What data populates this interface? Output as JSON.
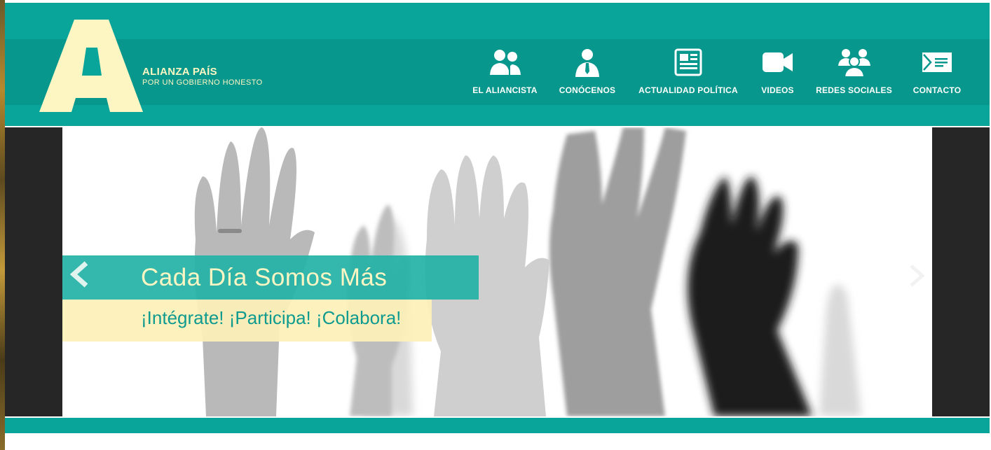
{
  "brand": {
    "title": "ALIANZA PAÍS",
    "subtitle": "POR UN GOBIERNO HONESTO",
    "logo_letter": "A",
    "logo_color": "#fdf6c3"
  },
  "colors": {
    "header_teal": "#0aa59a",
    "header_band": "#07978c",
    "slider_bg": "#262626",
    "banner_teal": "#23b2a6",
    "banner_yellow": "#fdf1b8"
  },
  "nav": {
    "items": [
      {
        "label": "EL ALIANCISTA",
        "icon": "users-icon"
      },
      {
        "label": "CONÓCENOS",
        "icon": "person-tie-icon"
      },
      {
        "label": "ACTUALIDAD POLÍTICA",
        "icon": "newspaper-icon"
      },
      {
        "label": "VIDEOS",
        "icon": "video-camera-icon"
      },
      {
        "label": "REDES SOCIALES",
        "icon": "group-icon"
      },
      {
        "label": "CONTACTO",
        "icon": "envelope-icon"
      }
    ]
  },
  "slider": {
    "headline": "Cada Día Somos Más",
    "tagline": "¡Intégrate!  ¡Participa!  ¡Colabora!",
    "prev_icon": "chevron-left-icon",
    "next_icon": "chevron-right-icon"
  }
}
